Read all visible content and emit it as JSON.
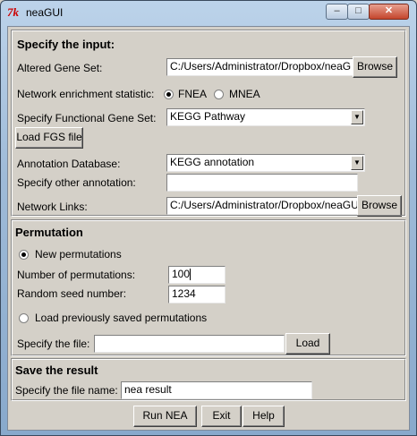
{
  "window": {
    "title": "neaGUI",
    "app_icon": "tk-feather-icon",
    "min_glyph": "–",
    "max_glyph": "□",
    "close_glyph": "✕"
  },
  "input": {
    "header": "Specify the input:",
    "altered_gene_set": {
      "label": "Altered Gene Set:",
      "value": "C:/Users/Administrator/Dropbox/neaG",
      "browse": "Browse"
    },
    "statistic": {
      "label": "Network enrichment statistic:",
      "options": [
        "FNEA",
        "MNEA"
      ],
      "selected": "FNEA"
    },
    "functional_gene_set": {
      "label": "Specify Functional Gene Set:",
      "value": "KEGG Pathway"
    },
    "load_fgs": "Load FGS file",
    "annotation_db": {
      "label": "Annotation Database:",
      "value": "KEGG annotation"
    },
    "other_annotation": {
      "label": "Specify other annotation:",
      "value": ""
    },
    "network_links": {
      "label": "Network Links:",
      "value": "C:/Users/Administrator/Dropbox/neaGU",
      "browse": "Browse"
    }
  },
  "permutation": {
    "header": "Permutation",
    "new_label": "New permutations",
    "num_label": "Number of permutations:",
    "num_value": "100",
    "seed_label": "Random seed number:",
    "seed_value": "1234",
    "load_saved_label": "Load previously saved permutations",
    "file_label": "Specify the file:",
    "file_value": "",
    "load_button": "Load",
    "selected": "new"
  },
  "save": {
    "header": "Save the result",
    "file_label": "Specify the file name:",
    "file_value": "nea result"
  },
  "actions": {
    "run": "Run NEA",
    "exit": "Exit",
    "help": "Help"
  },
  "colors": {
    "frame": "#9fbbd8",
    "client_bg": "#d4d0c8",
    "close_button": "#c4452c"
  }
}
